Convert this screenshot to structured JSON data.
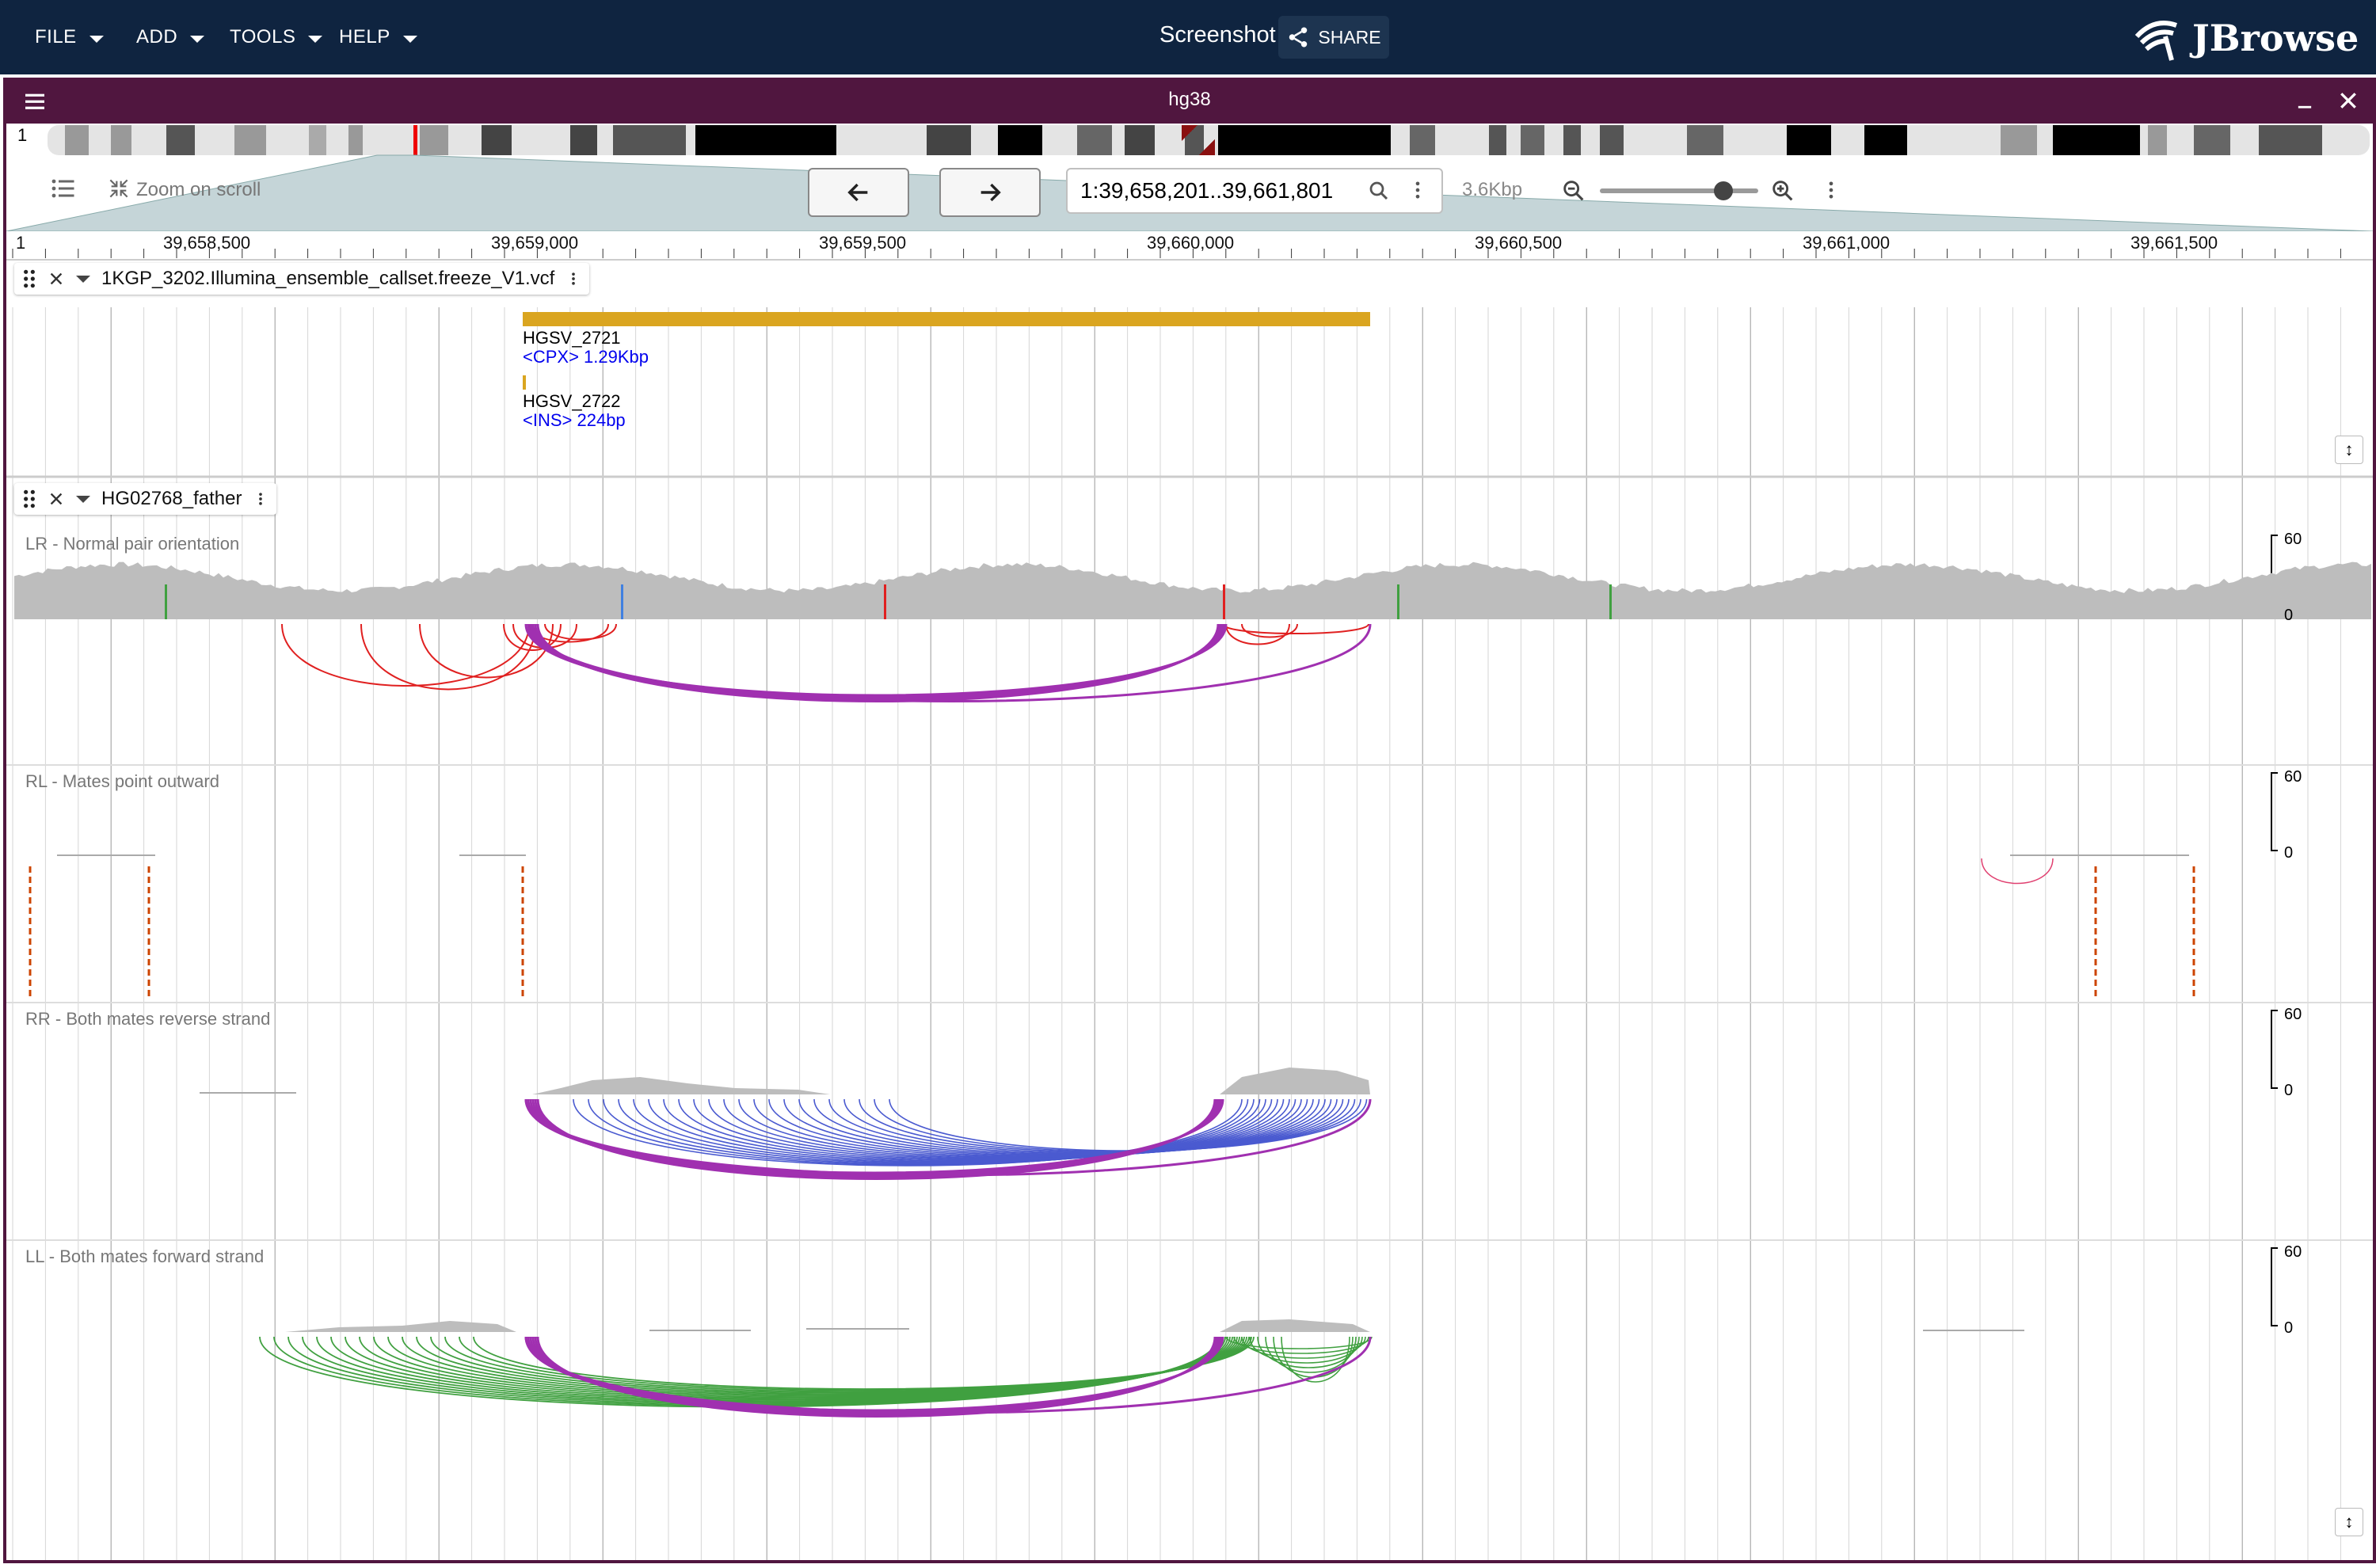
{
  "app": {
    "menus": [
      "FILE",
      "ADD",
      "TOOLS",
      "HELP"
    ],
    "screenshot_label": "Screenshot",
    "share_label": "SHARE",
    "logo_text": "JBrowse"
  },
  "view": {
    "title": "hg38",
    "chromosome": "1",
    "zoom_on_scroll": "Zoom on scroll",
    "location": "1:39,658,201..39,661,801",
    "span": "3.6Kbp",
    "zoom_level": 0.78
  },
  "ruler": {
    "start_label": "1",
    "ticks": [
      "39,658,500",
      "39,659,000",
      "39,659,500",
      "39,660,000",
      "39,660,500",
      "39,661,000",
      "39,661,500"
    ]
  },
  "tracks": [
    {
      "name": "1KGP_3202.Illumina_ensemble_callset.freeze_V1.vcf",
      "features": [
        {
          "name": "HGSV_2721",
          "desc": "<CPX> 1.29Kbp"
        },
        {
          "name": "HGSV_2722",
          "desc": "<INS> 224bp"
        }
      ]
    },
    {
      "name": "HG02768_father",
      "subtracks": [
        {
          "label": "LR - Normal pair orientation",
          "axis_max": "60",
          "axis_min": "0"
        },
        {
          "label": "RL - Mates point outward",
          "axis_max": "60",
          "axis_min": "0"
        },
        {
          "label": "RR - Both mates reverse strand",
          "axis_max": "60",
          "axis_min": "0"
        },
        {
          "label": "LL - Both mates forward strand",
          "axis_max": "60",
          "axis_min": "0"
        }
      ]
    }
  ],
  "colors": {
    "topbar": "#0f2440",
    "view_header": "#50163f",
    "vcf_feature": "#daa520",
    "arc_purple": "#a030b0",
    "arc_red": "#e02020",
    "arc_blue": "#4a5ad0",
    "arc_green": "#40a040",
    "coverage": "#bdbdbd"
  }
}
